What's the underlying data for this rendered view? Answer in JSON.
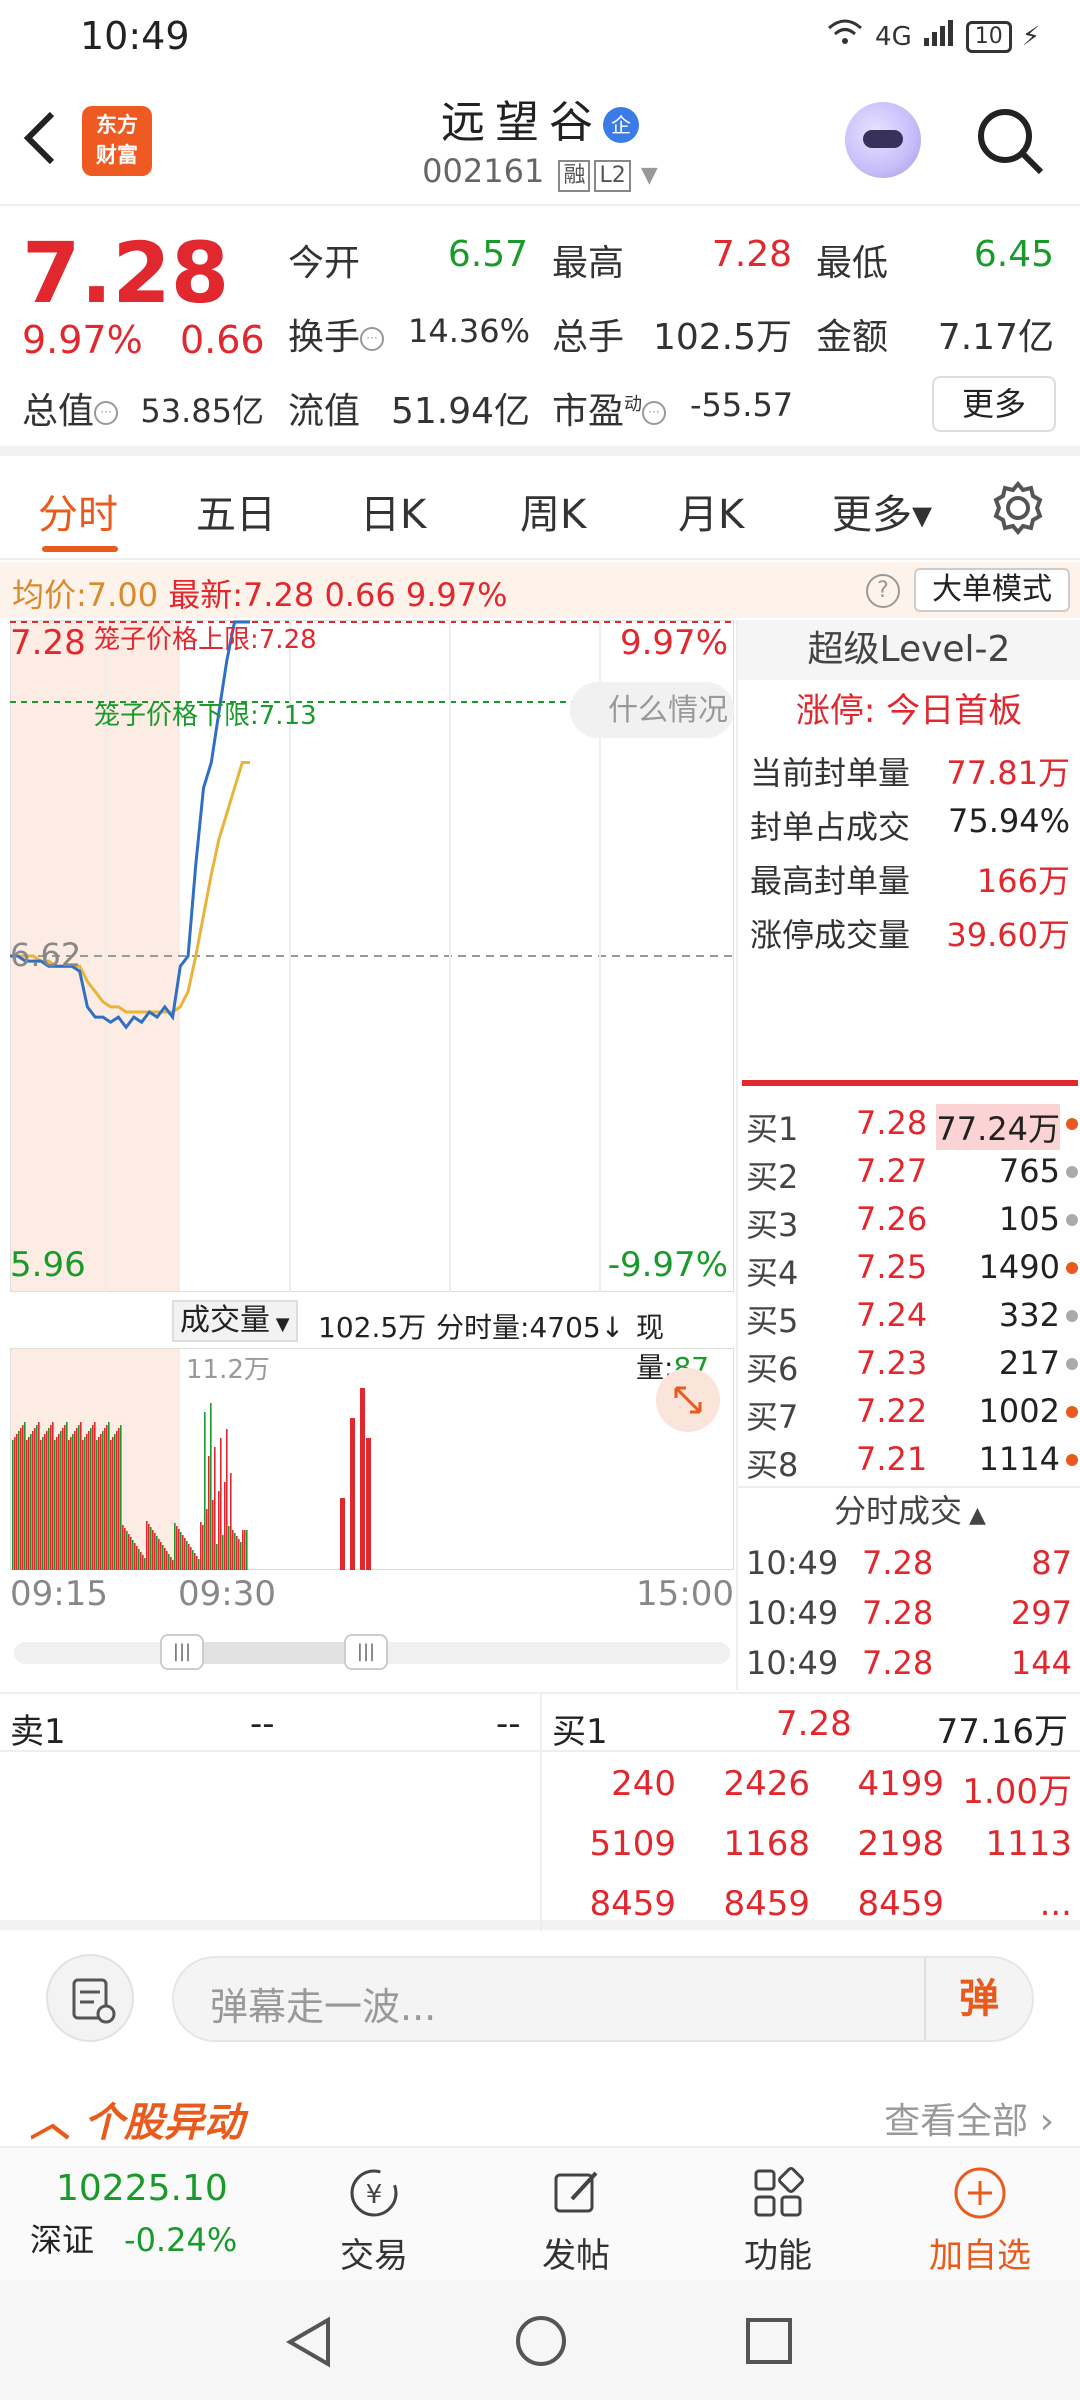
{
  "status": {
    "time": "10:49",
    "network": "4G",
    "battery": "10"
  },
  "header": {
    "back_icon": "back-arrow-icon",
    "logo_line1": "东方",
    "logo_line2": "财富",
    "stock_name": "远望谷",
    "badge": "企",
    "stock_code": "002161",
    "tag_margin": "融",
    "tag_level": "L2"
  },
  "quote": {
    "price": "7.28",
    "pct": "9.97%",
    "change": "0.66",
    "open_label": "今开",
    "open": "6.57",
    "high_label": "最高",
    "high": "7.28",
    "low_label": "最低",
    "low": "6.45",
    "turnover_label": "换手",
    "turnover": "14.36%",
    "volume_label": "总手",
    "volume": "102.5万",
    "amount_label": "金额",
    "amount": "7.17亿",
    "mktcap_label": "总值",
    "mktcap": "53.85亿",
    "float_label": "流值",
    "float": "51.94亿",
    "pe_label": "市盈",
    "pe_sup": "动",
    "pe": "-55.57",
    "more": "更多"
  },
  "tabs": [
    {
      "label": "分时"
    },
    {
      "label": "五日"
    },
    {
      "label": "日K"
    },
    {
      "label": "周K"
    },
    {
      "label": "月K"
    },
    {
      "label": "更多▾"
    }
  ],
  "infoline": {
    "avg_label": "均价:",
    "avg": "7.00",
    "latest_label": "最新:",
    "latest": "7.28",
    "change": "0.66",
    "pct": "9.97%",
    "big_order": "大单模式"
  },
  "chart": {
    "top_price": "7.28",
    "bottom_price": "5.96",
    "mid_price": "6.62",
    "top_pct": "9.97%",
    "bottom_pct": "-9.97%",
    "upper_limit_label": "笼子价格上限:",
    "upper_limit": "7.28",
    "lower_limit_label": "笼子价格下限:",
    "lower_limit": "7.13",
    "bubble": "什么情况"
  },
  "chart_data": {
    "type": "line",
    "series": [
      {
        "name": "",
        "values": [
          6.62,
          6.62,
          6.61,
          6.61,
          6.61,
          6.6,
          6.6,
          6.6,
          6.6,
          6.59,
          6.52,
          6.5,
          6.5,
          6.49,
          6.5,
          6.48,
          6.5,
          6.49,
          6.51,
          6.5,
          6.52,
          6.5,
          6.6,
          6.62,
          6.8,
          6.95,
          7.0,
          7.1,
          7.2,
          7.28,
          7.28,
          7.28
        ]
      },
      {
        "name": "",
        "values": [
          6.62,
          6.62,
          6.62,
          6.62,
          6.61,
          6.61,
          6.6,
          6.6,
          6.6,
          6.6,
          6.57,
          6.55,
          6.53,
          6.52,
          6.52,
          6.51,
          6.51,
          6.51,
          6.51,
          6.51,
          6.51,
          6.51,
          6.52,
          6.55,
          6.62,
          6.7,
          6.78,
          6.85,
          6.9,
          6.95,
          7.0,
          7.0
        ]
      }
    ],
    "ylim": [
      5.96,
      7.28
    ]
  },
  "volume": {
    "selector": "成交量",
    "total": "102.5万",
    "minute_label": "分时量:",
    "minute_val": "4705↓",
    "now_label": "现量:",
    "now_val": "87",
    "max_label": "11.2万",
    "time_start": "09:15",
    "time_open": "09:30",
    "time_end": "15:00"
  },
  "level2": {
    "title": "超级Level-2",
    "limit_up": "涨停: 今日首板",
    "rows": [
      {
        "k": "当前封单量",
        "v": "77.81万"
      },
      {
        "k": "封单占成交",
        "v": "75.94%"
      },
      {
        "k": "最高封单量",
        "v": "166万"
      },
      {
        "k": "涨停成交量",
        "v": "39.60万"
      }
    ],
    "bids": [
      {
        "n": "买1",
        "p": "7.28",
        "q": "77.24万",
        "dot": "#e95b1c"
      },
      {
        "n": "买2",
        "p": "7.27",
        "q": "765",
        "dot": "#aaaaaa"
      },
      {
        "n": "买3",
        "p": "7.26",
        "q": "105",
        "dot": "#aaaaaa"
      },
      {
        "n": "买4",
        "p": "7.25",
        "q": "1490",
        "dot": "#e95b1c"
      },
      {
        "n": "买5",
        "p": "7.24",
        "q": "332",
        "dot": "#aaaaaa"
      },
      {
        "n": "买6",
        "p": "7.23",
        "q": "217",
        "dot": "#aaaaaa"
      },
      {
        "n": "买7",
        "p": "7.22",
        "q": "1002",
        "dot": "#e95b1c"
      },
      {
        "n": "买8",
        "p": "7.21",
        "q": "1114",
        "dot": "#e95b1c"
      }
    ],
    "ticks_title": "分时成交",
    "ticks": [
      {
        "t": "10:49",
        "p": "7.28",
        "q": "87"
      },
      {
        "t": "10:49",
        "p": "7.28",
        "q": "297"
      },
      {
        "t": "10:49",
        "p": "7.28",
        "q": "144"
      }
    ]
  },
  "book": {
    "sell1": "卖1",
    "sell1_p": "--",
    "sell1_q": "--",
    "buy1": "买1",
    "buy1_p": "7.28",
    "buy1_q": "77.16万",
    "cells": [
      [
        "240",
        "2426",
        "4199",
        "1.00万"
      ],
      [
        "5109",
        "1168",
        "2198",
        "1113"
      ],
      [
        "8459",
        "8459",
        "8459",
        "..."
      ]
    ]
  },
  "danmu": {
    "placeholder": "弹幕走一波...",
    "button": "弹"
  },
  "abnormal": {
    "title": "个股异动",
    "view_all": "查看全部"
  },
  "bottom": {
    "index_value": "10225.10",
    "index_name": "深证",
    "index_pct": "-0.24%",
    "items": [
      {
        "label": "交易"
      },
      {
        "label": "发帖"
      },
      {
        "label": "功能"
      },
      {
        "label": "加自选"
      }
    ]
  },
  "colors": {
    "up": "#e0282e",
    "down": "#1a9a2a",
    "accent": "#e95b1c"
  }
}
